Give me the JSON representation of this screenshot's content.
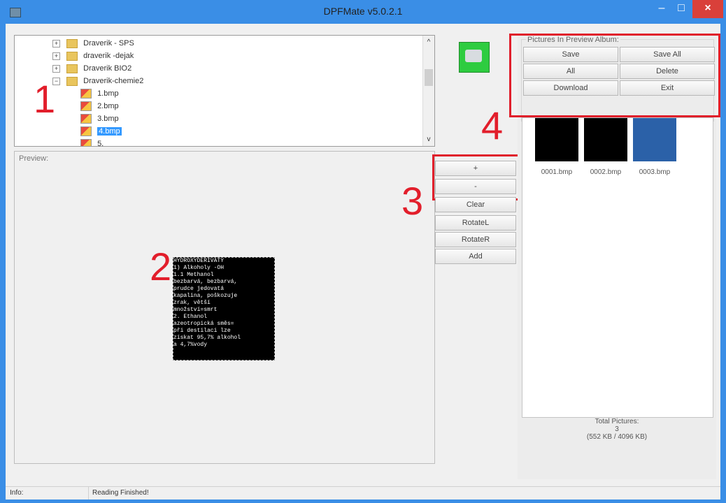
{
  "window": {
    "title": "DPFMate v5.0.2.1",
    "controls": {
      "minimize": "–",
      "maximize": "□",
      "close": "×"
    }
  },
  "tree": {
    "folders": [
      {
        "label": "Draverik - SPS",
        "expander": "+"
      },
      {
        "label": "draverik -dejak",
        "expander": "+"
      },
      {
        "label": "Draverik BIO2",
        "expander": "+"
      },
      {
        "label": "Draverik-chemie2",
        "expander": "−"
      }
    ],
    "files": [
      "1.bmp",
      "2.bmp",
      "3.bmp",
      "4.bmp",
      "5."
    ],
    "selected_file": "4.bmp",
    "scroll": {
      "up": "^",
      "down": "v"
    }
  },
  "preview": {
    "label": "Preview:",
    "image_text": [
      "HYDROXYDERIVATY",
      "1) Alkoholy -OH",
      "1.1 Methanol",
      "bezbarvá, bezbarvá,",
      "prudce jedovatá",
      "kapalina, poškozuje",
      "zrak, větší",
      "množství=smrt",
      "2. Ethanol",
      "azeotropická směs=",
      "při destilaci lze",
      "získat 95,7% alkohol",
      "a 4,7%vody"
    ]
  },
  "actions": {
    "plus": "+",
    "minus": "-",
    "clear": "Clear",
    "rotate_left": "RotateL",
    "rotate_right": "RotateR",
    "add": "Add"
  },
  "album": {
    "group_label": "Pictures In Preview Album:",
    "buttons": {
      "save": "Save",
      "save_all": "Save All",
      "all": "All",
      "delete": "Delete",
      "download": "Download",
      "exit": "Exit"
    },
    "thumbnails": [
      {
        "name": "0001.bmp",
        "style": "black"
      },
      {
        "name": "0002.bmp",
        "style": "black"
      },
      {
        "name": "0003.bmp",
        "style": "blue"
      }
    ],
    "total_label": "Total Pictures:",
    "total_count": "3",
    "total_size": "(552 KB / 4096 KB)"
  },
  "annotations": {
    "n1": "1",
    "n2": "2",
    "n3": "3",
    "n4": "4"
  },
  "statusbar": {
    "info_label": "Info:",
    "message": "Reading Finished!"
  },
  "colors": {
    "accent": "#3a8ee6",
    "annotation_red": "#e01f2b",
    "close_red": "#d9403a"
  }
}
